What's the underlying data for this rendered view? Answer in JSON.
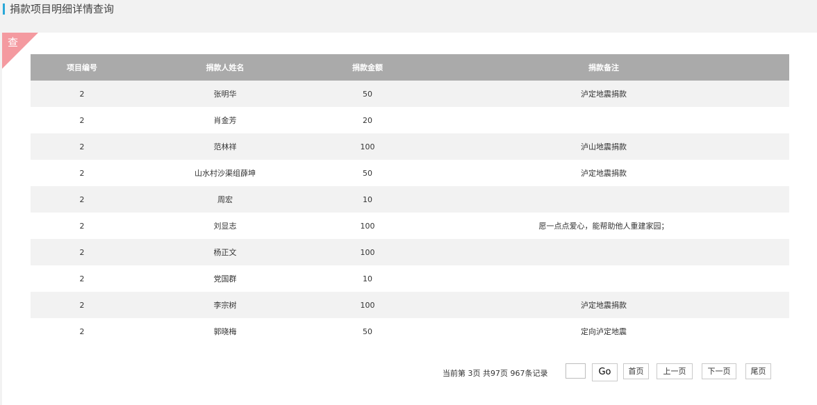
{
  "header": {
    "title": "捐款项目明细详情查询",
    "accent_color": "#2aa8d8"
  },
  "panel": {
    "corner_tag": "查",
    "corner_color": "#f49aa0"
  },
  "table": {
    "columns": [
      "项目编号",
      "捐款人姓名",
      "捐款金额",
      "捐款备注"
    ],
    "rows": [
      [
        "2",
        "张明华",
        "50",
        "泸定地震捐款"
      ],
      [
        "2",
        "肖金芳",
        "20",
        ""
      ],
      [
        "2",
        "范林祥",
        "100",
        "泸山地震捐款"
      ],
      [
        "2",
        "山水村沙渠组薛坤",
        "50",
        "泸定地震捐款"
      ],
      [
        "2",
        "周宏",
        "10",
        ""
      ],
      [
        "2",
        "刘显志",
        "100",
        "愿一点点爱心，能帮助他人重建家园；"
      ],
      [
        "2",
        "杨正文",
        "100",
        ""
      ],
      [
        "2",
        "党国群",
        "10",
        ""
      ],
      [
        "2",
        "李宗树",
        "100",
        "泸定地震捐款"
      ],
      [
        "2",
        "郭晓梅",
        "50",
        "定向泸定地震"
      ]
    ]
  },
  "pager": {
    "info": "当前第  3页   共97页   967条记录",
    "input_value": "",
    "go_label": "Go",
    "first_label": "首页",
    "prev_label": "上一页",
    "next_label": "下一页",
    "last_label": "尾页"
  }
}
